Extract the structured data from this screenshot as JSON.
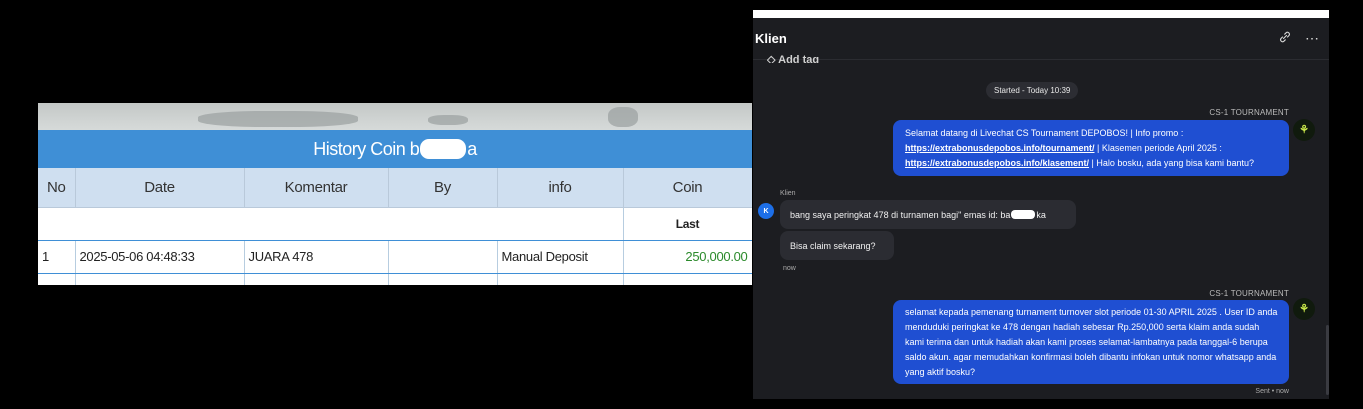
{
  "history": {
    "title_prefix": "History Coin b",
    "title_suffix": "a",
    "columns": [
      "No",
      "Date",
      "Komentar",
      "By",
      "info",
      "Coin"
    ],
    "subheader_coin": "Last",
    "rows": [
      {
        "no": "1",
        "date": "2025-05-06 04:48:33",
        "komentar": "JUARA 478",
        "by": "",
        "info": "Manual Deposit",
        "coin": "250,000.00"
      }
    ]
  },
  "chat": {
    "title": "Klien",
    "add_tag": "Add tag",
    "started": "Started - Today 10:39",
    "agent_name_1": "CS-1 TOURNAMENT",
    "agent_msg_1": {
      "line1": "Selamat datang di Livechat CS Tournament DEPOBOS! | Info promo :",
      "link1": "https://extrabonusdepobos.info/tournament/",
      "mid": " | Klasemen periode April 2025 :",
      "link2": "https://extrabonusdepobos.info/klasement/",
      "end": " | Halo bosku, ada yang bisa kami bantu?"
    },
    "client_name": "Klien",
    "client_avatar": "K",
    "client_msg_1_prefix": "bang saya peringkat 478 di turnamen bagi\" emas id: ba",
    "client_msg_1_suffix": "ka",
    "client_msg_2": "Bisa claim sekarang?",
    "client_time": "now",
    "agent_name_2": "CS-1 TOURNAMENT",
    "agent_msg_2": "selamat kepada pemenang turnament turnover slot periode 01-30 APRIL 2025 . User ID anda menduduki peringkat ke 478 dengan hadiah sebesar Rp.250,000 serta klaim anda sudah kami terima dan untuk hadiah akan kami proses selamat-lambatnya pada tanggal-6 berupa saldo akun. agar memudahkan konfirmasi boleh dibantu infokan untuk nomor whatsapp anda yang aktif bosku?",
    "sent_status": "Sent • now",
    "icons": {
      "link": "link-icon",
      "more": "more-icon",
      "tag": "tag-icon",
      "logo": "depobos-logo-icon"
    }
  }
}
